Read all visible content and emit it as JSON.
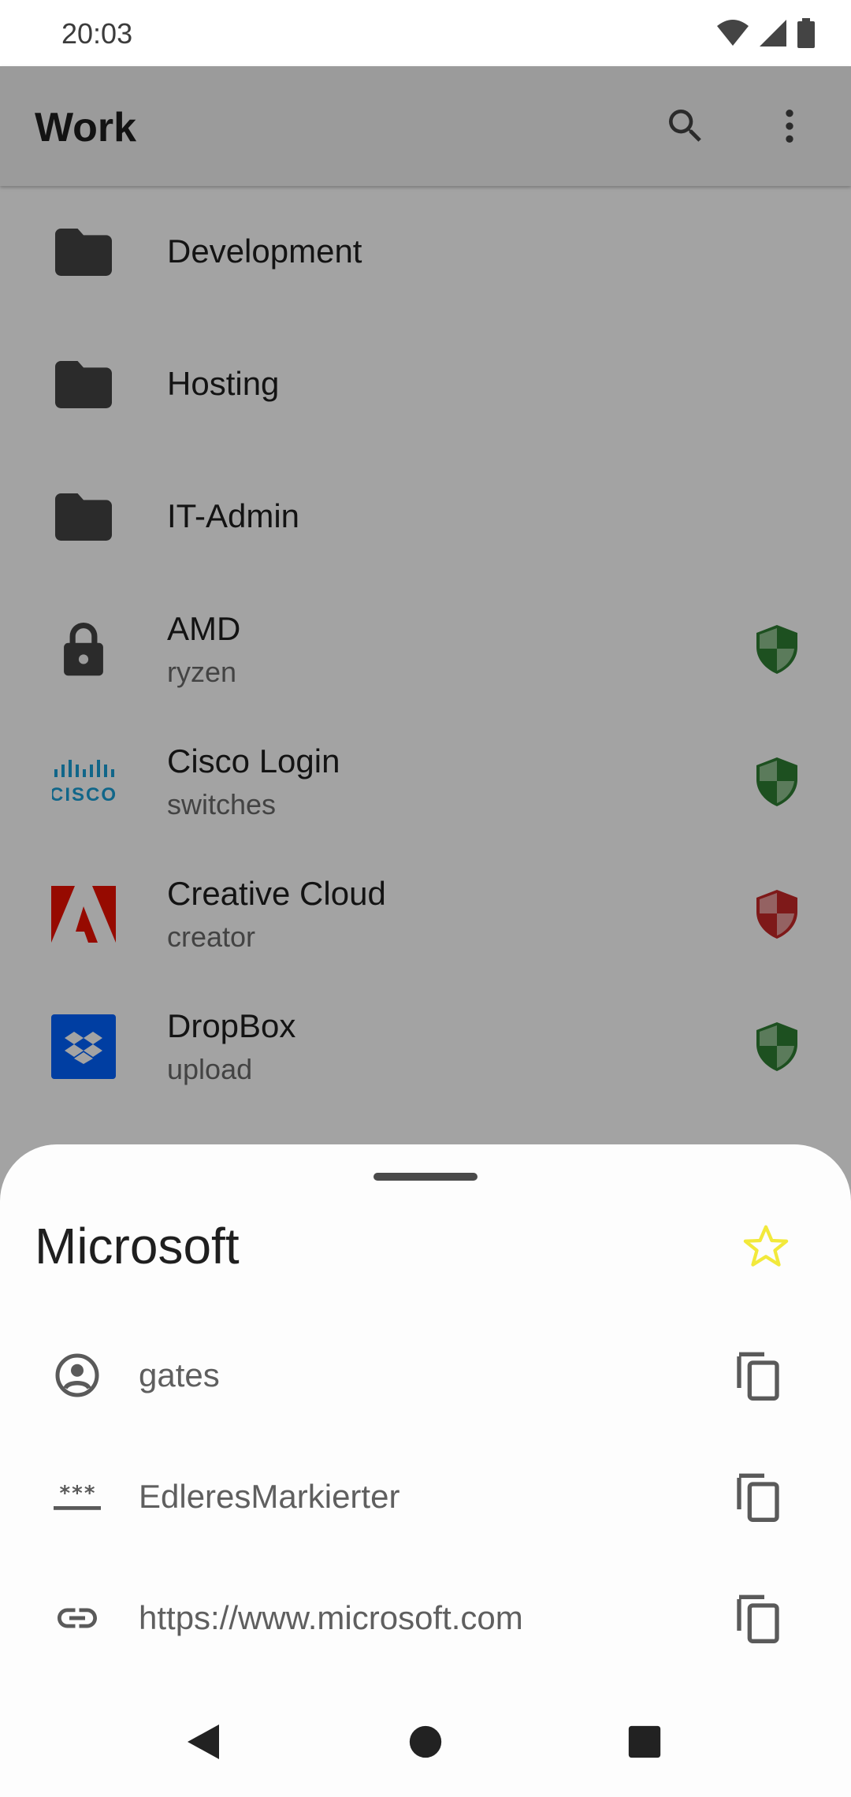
{
  "status_bar": {
    "time": "20:03",
    "icons": [
      "wifi-icon",
      "signal-icon",
      "battery-icon"
    ]
  },
  "app_bar": {
    "title": "Work",
    "actions": [
      "search-icon",
      "more-vert-icon"
    ]
  },
  "entries": [
    {
      "type": "folder",
      "title": "Development",
      "icon": "folder-icon"
    },
    {
      "type": "folder",
      "title": "Hosting",
      "icon": "folder-icon"
    },
    {
      "type": "folder",
      "title": "IT-Admin",
      "icon": "folder-icon"
    },
    {
      "type": "entry",
      "title": "AMD",
      "subtitle": "ryzen",
      "icon": "lock-icon",
      "strength": "good"
    },
    {
      "type": "entry",
      "title": "Cisco Login",
      "subtitle": "switches",
      "icon": "cisco-logo",
      "strength": "good"
    },
    {
      "type": "entry",
      "title": "Creative Cloud",
      "subtitle": "creator",
      "icon": "adobe-logo",
      "strength": "weak"
    },
    {
      "type": "entry",
      "title": "DropBox",
      "subtitle": "upload",
      "icon": "dropbox-logo",
      "strength": "good"
    }
  ],
  "sheet": {
    "title": "Microsoft",
    "favorite_icon": "star-icon",
    "fields": [
      {
        "icon": "account-circle-icon",
        "value": "gates"
      },
      {
        "icon": "password-icon",
        "value": "EdleresMarkierter"
      },
      {
        "icon": "link-icon",
        "value": "https://www.microsoft.com"
      }
    ]
  },
  "colors": {
    "strength_good": "#2e7d32",
    "strength_weak": "#c62828",
    "star": "#f2e93b",
    "cisco": "#1ba0d7",
    "adobe": "#eb1000",
    "dropbox": "#0061fe"
  },
  "nav_bar": [
    "back-icon",
    "home-icon",
    "recents-icon"
  ]
}
